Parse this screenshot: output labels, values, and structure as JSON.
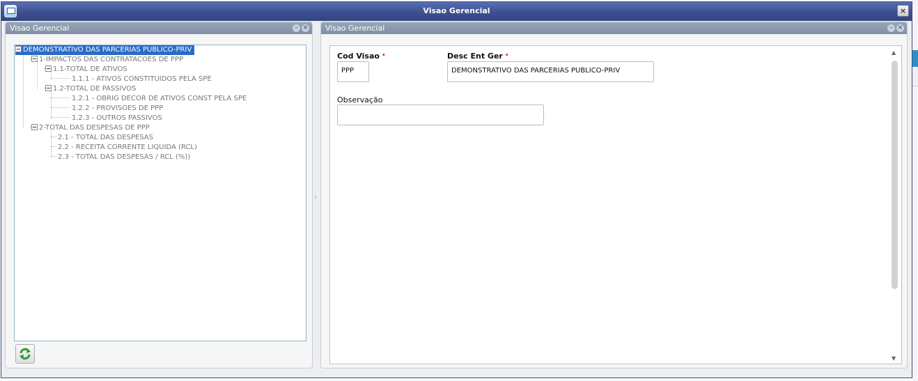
{
  "window": {
    "title": "Visao Gerencial",
    "close_label": "×"
  },
  "left_panel": {
    "title": "Visao Gerencial",
    "min_label": "–",
    "close_label": "×",
    "tree": [
      {
        "label": "DEMONSTRATIVO DAS PARCERIAS PUBLICO-PRIV",
        "selected": true
      },
      {
        "label": "1-IMPACTOS DAS CONTRATACOES DE PPP"
      },
      {
        "label": "1.1-TOTAL DE ATIVOS"
      },
      {
        "label": "1.1.1 - ATIVOS CONSTITUIDOS PELA SPE"
      },
      {
        "label": "1.2-TOTAL DE PASSIVOS"
      },
      {
        "label": "1.2.1 - OBRIG DECOR DE ATIVOS CONST PELA SPE"
      },
      {
        "label": "1.2.2 - PROVISOES DE PPP"
      },
      {
        "label": "1.2.3 - OUTROS PASSIVOS"
      },
      {
        "label": "2-TOTAL DAS DESPESAS DE PPP"
      },
      {
        "label": "2.1 - TOTAL DAS DESPESAS"
      },
      {
        "label": "2.2 - RECEITA CORRENTE LIQUIDA (RCL)"
      },
      {
        "label": "2.3 - TOTAL DAS DESPESAS / RCL (%))"
      }
    ],
    "refresh_icon": "refresh-icon"
  },
  "right_panel": {
    "title": "Visao Gerencial",
    "min_label": "–",
    "close_label": "×",
    "form": {
      "cod_visao_label": "Cod Visao",
      "cod_visao_value": "PPP",
      "desc_label": "Desc Ent Ger",
      "desc_value": "DEMONSTRATIVO DAS PARCERIAS PUBLICO-PRIV",
      "obs_label": "Observação",
      "obs_value": "",
      "required_mark": "•"
    }
  },
  "colors": {
    "titlebar": "#3d4f91",
    "selection": "#2a6bc7",
    "required": "#e23b2c"
  }
}
